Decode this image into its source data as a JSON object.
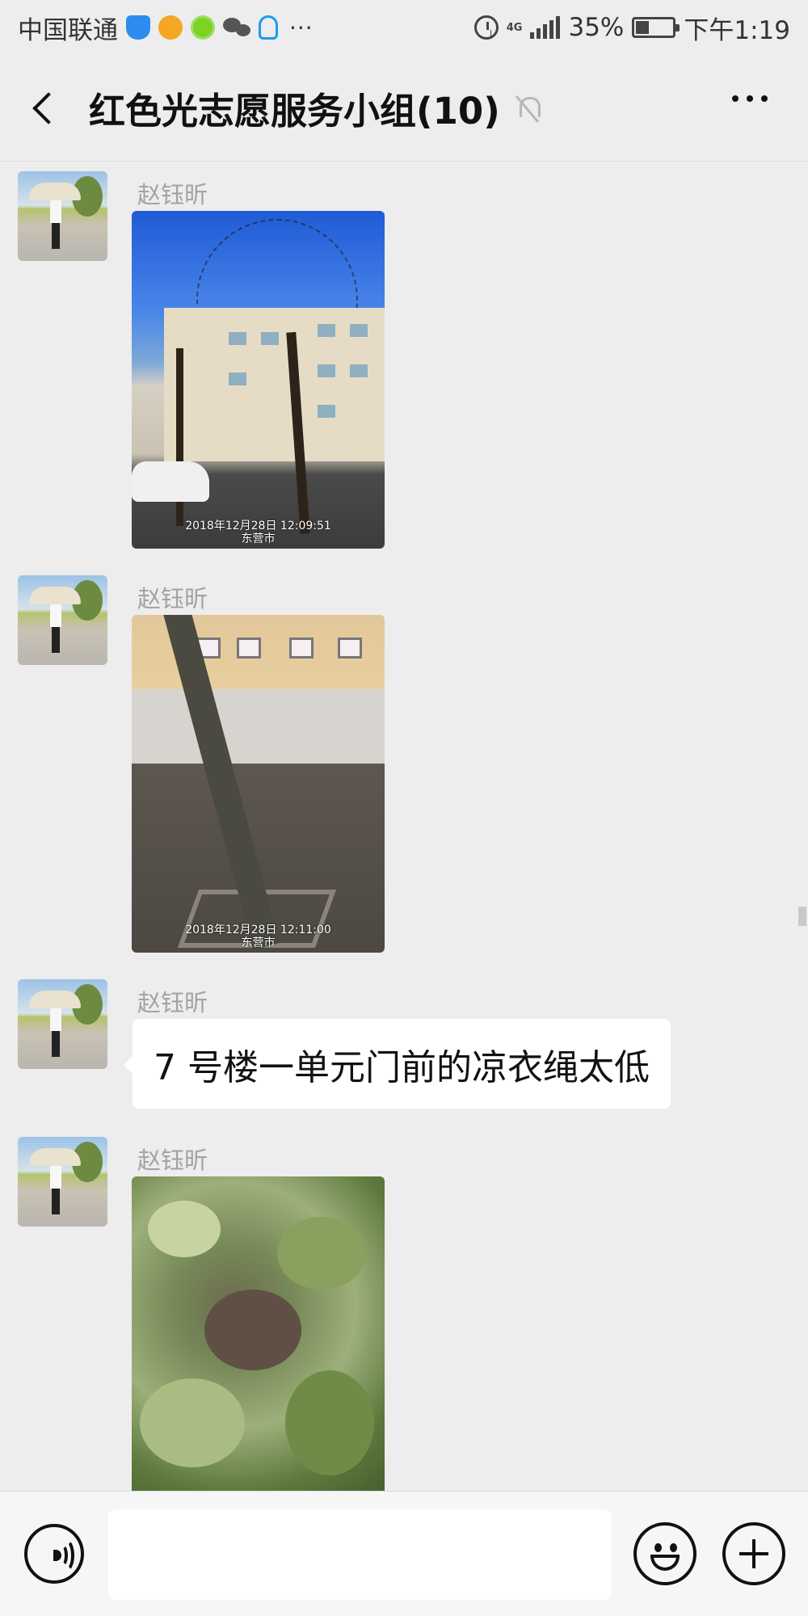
{
  "status_bar": {
    "carrier": "中国联通",
    "more": "···",
    "network": "4G",
    "battery": "35%",
    "time": "下午1:19"
  },
  "header": {
    "title": "红色光志愿服务小组(10)"
  },
  "messages": [
    {
      "sender": "赵钰昕",
      "type": "image",
      "stamp_date": "2018年12月28日 12:09:51",
      "stamp_place": "东营市"
    },
    {
      "sender": "赵钰昕",
      "type": "image",
      "stamp_date": "2018年12月28日 12:11:00",
      "stamp_place": "东营市"
    },
    {
      "sender": "赵钰昕",
      "type": "text",
      "text": "7 号楼一单元门前的凉衣绳太低"
    },
    {
      "sender": "赵钰昕",
      "type": "image"
    }
  ],
  "input_bar": {
    "text_value": ""
  },
  "icons": {
    "back": "back-chevron-icon",
    "mute": "mute-bell-icon",
    "more": "more-dots-icon",
    "voice": "voice-icon",
    "emoji": "emoji-icon",
    "plus": "plus-icon"
  }
}
